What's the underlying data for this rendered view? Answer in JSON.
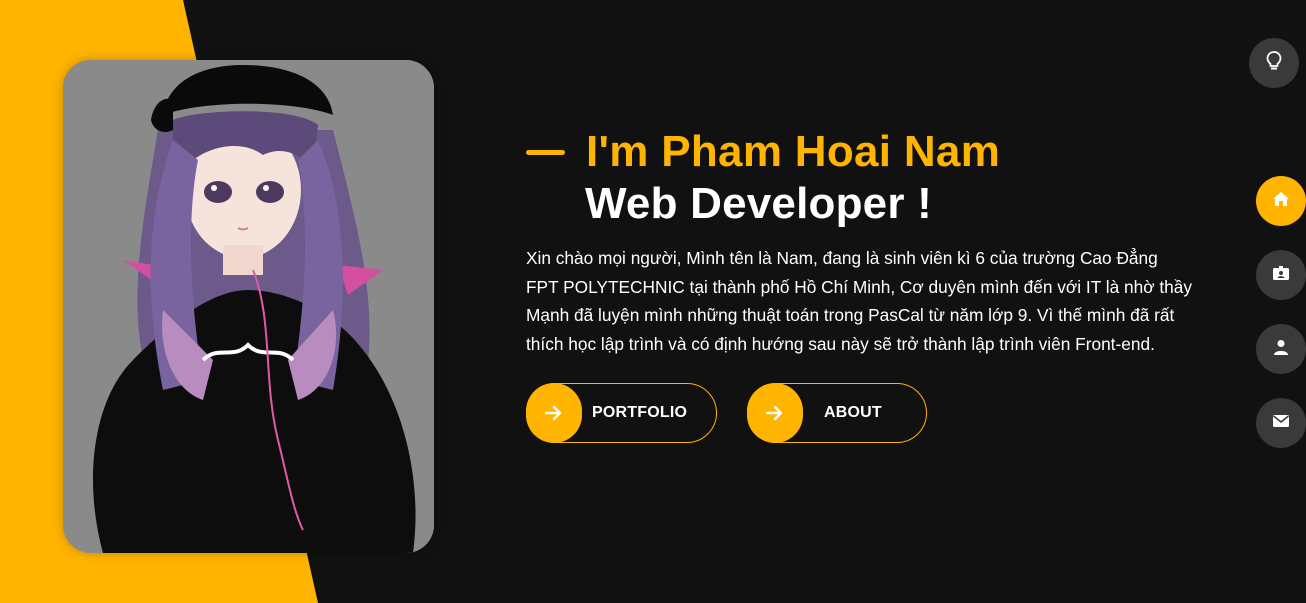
{
  "theme_toggle": {
    "icon": "lightbulb-icon"
  },
  "hero": {
    "title_line1": "I'm Pham Hoai Nam",
    "title_line2": "Web Developer !",
    "bio": "Xin chào mọi người, Mình tên là Nam, đang là sinh viên kì 6 của trường Cao Đẳng FPT POLYTECHNIC tại thành phố Hồ Chí Minh, Cơ duyên mình đến với IT là nhờ thầy Mạnh đã luyện mình những thuật toán trong PasCal từ năm lớp 9. Vì thế mình đã rất thích học lập trình và có định hướng sau này sẽ trở thành lập trình viên Front-end.",
    "buttons": [
      {
        "label": "PORTFOLIO",
        "icon": "arrow-right-icon"
      },
      {
        "label": "ABOUT",
        "icon": "arrow-right-icon"
      }
    ]
  },
  "side_nav": [
    {
      "icon": "home-icon",
      "active": true
    },
    {
      "icon": "id-card-icon",
      "active": false
    },
    {
      "icon": "user-icon",
      "active": false
    },
    {
      "icon": "envelope-icon",
      "active": false
    }
  ],
  "colors": {
    "accent": "#ffb400",
    "background": "#111111",
    "nav_inactive": "#3a3a3a"
  }
}
